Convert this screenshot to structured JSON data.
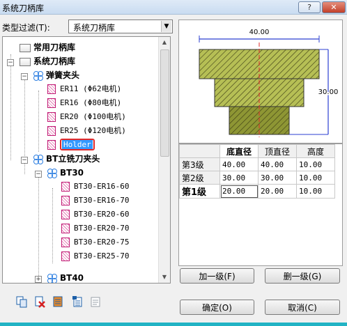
{
  "window": {
    "title": "系统刀柄库",
    "help_label": "?",
    "close_label": "✕"
  },
  "filter": {
    "label": "类型过滤(T):",
    "value": "系统刀柄库"
  },
  "tree": {
    "nodes": [
      {
        "label": "常用刀柄库"
      },
      {
        "label": "系统刀柄库"
      },
      {
        "label": "弹簧夹头"
      },
      {
        "label": "ER11 (Φ62电机)"
      },
      {
        "label": "ER16 (Φ80电机)"
      },
      {
        "label": "ER20 (Φ100电机)"
      },
      {
        "label": "ER25 (Φ120电机)"
      },
      {
        "label": "Holder"
      },
      {
        "label": "BT立铣刀夹头"
      },
      {
        "label": "BT30"
      },
      {
        "label": "BT30-ER16-60"
      },
      {
        "label": "BT30-ER16-70"
      },
      {
        "label": "BT30-ER20-60"
      },
      {
        "label": "BT30-ER20-70"
      },
      {
        "label": "BT30-ER20-75"
      },
      {
        "label": "BT30-ER25-70"
      },
      {
        "label": "BT40"
      }
    ]
  },
  "preview": {
    "width_dim": "40.00",
    "height_dim": "30.00"
  },
  "grid": {
    "headers": [
      "",
      "底直径",
      "顶直径",
      "高度"
    ],
    "rows": [
      {
        "label": "第3级",
        "cells": [
          "40.00",
          "40.00",
          "10.00"
        ]
      },
      {
        "label": "第2级",
        "cells": [
          "30.00",
          "30.00",
          "10.00"
        ]
      },
      {
        "label": "第1级",
        "cells": [
          "20.00",
          "20.00",
          "10.00"
        ]
      }
    ]
  },
  "buttons": {
    "add_level": "加一级(F)",
    "del_level": "删一级(G)",
    "ok": "确定(O)",
    "cancel": "取消(C)"
  },
  "toolbar_icons": [
    "copy-icon",
    "delete-icon",
    "list-icon",
    "paste-icon",
    "properties-icon"
  ],
  "colors": {
    "title_bg": "#c9dcf1",
    "selection": "#3399ff",
    "selection_outline": "#e02a2a",
    "hatch": "#9aa53a",
    "guide": "#e02a2a",
    "dim": "#2b3fd1"
  }
}
